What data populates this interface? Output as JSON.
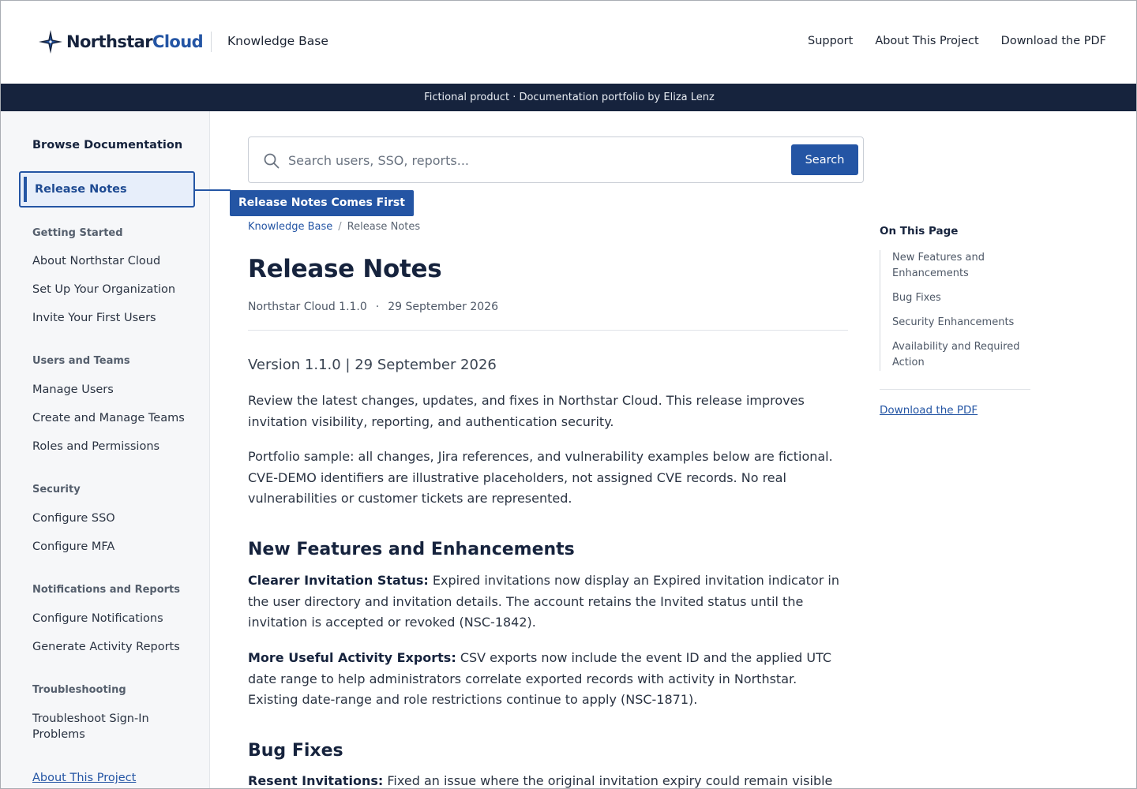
{
  "header": {
    "brand_part1": "Northstar",
    "brand_part2": "Cloud",
    "section_label": "Knowledge Base",
    "nav": [
      "Support",
      "About This Project",
      "Download the PDF"
    ]
  },
  "banner": "Fictional product · Documentation portfolio by Eliza Lenz",
  "sidebar": {
    "title": "Browse Documentation",
    "active_item": "Release Notes",
    "groups": [
      {
        "label": "Getting Started",
        "items": [
          "About Northstar Cloud",
          "Set Up Your Organization",
          "Invite Your First Users"
        ]
      },
      {
        "label": "Users and Teams",
        "items": [
          "Manage Users",
          "Create and Manage Teams",
          "Roles and Permissions"
        ]
      },
      {
        "label": "Security",
        "items": [
          "Configure SSO",
          "Configure MFA"
        ]
      },
      {
        "label": "Notifications and Reports",
        "items": [
          "Configure Notifications",
          "Generate Activity Reports"
        ]
      },
      {
        "label": "Troubleshooting",
        "items": [
          "Troubleshoot Sign-In Problems"
        ]
      }
    ],
    "footer_link": "About This Project"
  },
  "callout": "Release Notes Comes First",
  "search": {
    "placeholder": "Search users, SSO, reports...",
    "button_label": "Search"
  },
  "breadcrumb": {
    "root": "Knowledge Base",
    "separator": "/",
    "current": "Release Notes"
  },
  "article": {
    "title": "Release Notes",
    "product_version": "Northstar Cloud 1.1.0",
    "meta_separator": "·",
    "date": "29 September 2026",
    "version_line": "Version 1.1.0 | 29 September 2026",
    "intro": "Review the latest changes, updates, and fixes in Northstar Cloud. This release improves invitation visibility, reporting, and authentication security.",
    "disclaimer": "Portfolio sample: all changes, Jira references, and vulnerability examples below are fictional. CVE-DEMO identifiers are illustrative placeholders, not assigned CVE records. No real vulnerabilities or customer tickets are represented.",
    "section1_heading": "New Features and Enhancements",
    "item1_title": "Clearer Invitation Status:",
    "item1_text": "Expired invitations now display an Expired invitation indicator in the user directory and invitation details. The account retains the Invited status until the invitation is accepted or revoked (NSC-1842).",
    "item2_title": "More Useful Activity Exports:",
    "item2_text": "CSV exports now include the event ID and the applied UTC date range to help administrators correlate exported records with activity in Northstar. Existing date-range and role restrictions continue to apply (NSC-1871).",
    "section2_heading": "Bug Fixes",
    "item3_title": "Resent Invitations:",
    "item3_text": "Fixed an issue where the original invitation expiry could remain visible"
  },
  "toc": {
    "title": "On This Page",
    "items": [
      "New Features and Enhancements",
      "Bug Fixes",
      "Security Enhancements",
      "Availability and Required Action"
    ],
    "download_link": "Download the PDF"
  },
  "colors": {
    "accent": "#2455a4",
    "navy": "#16233d"
  },
  "icons": [
    "north-star-logo-icon",
    "search-icon"
  ]
}
